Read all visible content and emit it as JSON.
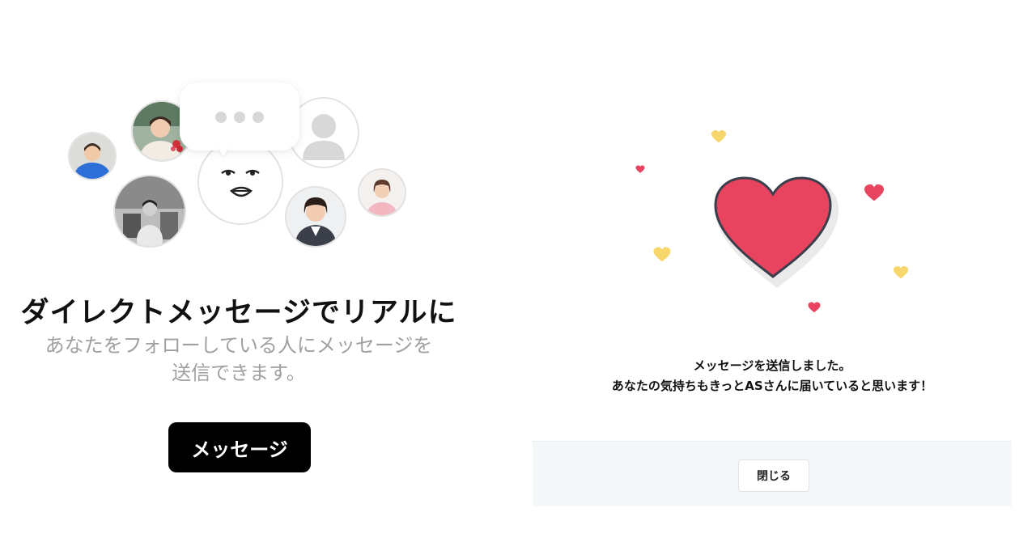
{
  "left_panel": {
    "title": "ダイレクトメッセージでリアルに",
    "description_line1": "あなたをフォローしている人にメッセージを",
    "description_line2": "送信できます。",
    "message_button_label": "メッセージ"
  },
  "right_panel": {
    "message_line1": "メッセージを送信しました。",
    "message_line2": "あなたの気持ちもきっとASさんに届いていると思います！",
    "close_button_label": "閉じる"
  },
  "colors": {
    "heart_red": "#e8435f",
    "heart_outline": "#3a3f4b",
    "heart_yellow": "#f7d66b",
    "button_black": "#000000",
    "footer_bg": "#f5f8f9"
  },
  "icons": [
    "user-placeholder-icon",
    "typing-dots-icon",
    "big-heart-icon",
    "small-heart-icon"
  ]
}
